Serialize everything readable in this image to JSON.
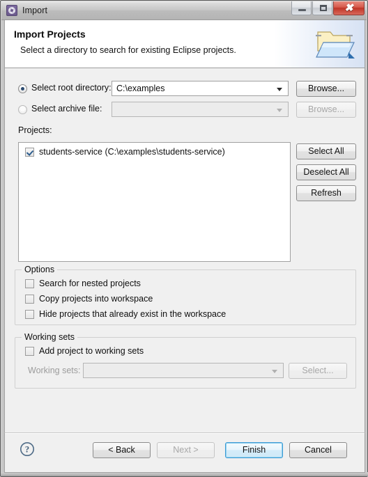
{
  "window": {
    "title": "Import",
    "icon": "eclipse-import-icon",
    "controls": {
      "minimize": "minimize-icon",
      "maximize": "maximize-icon",
      "close": "close-icon"
    }
  },
  "header": {
    "title": "Import Projects",
    "subtitle": "Select a directory to search for existing Eclipse projects.",
    "icon": "open-folder-icon"
  },
  "source": {
    "root_directory": {
      "label": "Select root directory:",
      "selected": true,
      "value": "C:\\examples",
      "browse_label": "Browse...",
      "browse_enabled": true
    },
    "archive_file": {
      "label": "Select archive file:",
      "selected": false,
      "value": "",
      "browse_label": "Browse...",
      "browse_enabled": false
    }
  },
  "projects": {
    "label": "Projects:",
    "items": [
      {
        "checked": true,
        "name": "students-service (C:\\examples\\students-service)"
      }
    ],
    "buttons": {
      "select_all": "Select All",
      "deselect_all": "Deselect All",
      "refresh": "Refresh"
    }
  },
  "options": {
    "caption": "Options",
    "items": [
      {
        "label": "Search for nested projects",
        "checked": false
      },
      {
        "label": "Copy projects into workspace",
        "checked": false
      },
      {
        "label": "Hide projects that already exist in the workspace",
        "checked": false
      }
    ]
  },
  "working_sets": {
    "caption": "Working sets",
    "add_checkbox": {
      "label": "Add project to working sets",
      "checked": false
    },
    "field_label": "Working sets:",
    "field_value": "",
    "select_label": "Select...",
    "enabled": false
  },
  "footer": {
    "help": "help-icon",
    "back": "< Back",
    "next": "Next >",
    "finish": "Finish",
    "cancel": "Cancel",
    "next_enabled": false,
    "default_button": "Finish"
  },
  "colors": {
    "dialog_bg": "#f0f0f0",
    "header_bg": "#ffffff",
    "accent_default_button": "#3c9ad4",
    "radio_dot": "#2b4a6f",
    "check_mark": "#2d5d8e"
  }
}
